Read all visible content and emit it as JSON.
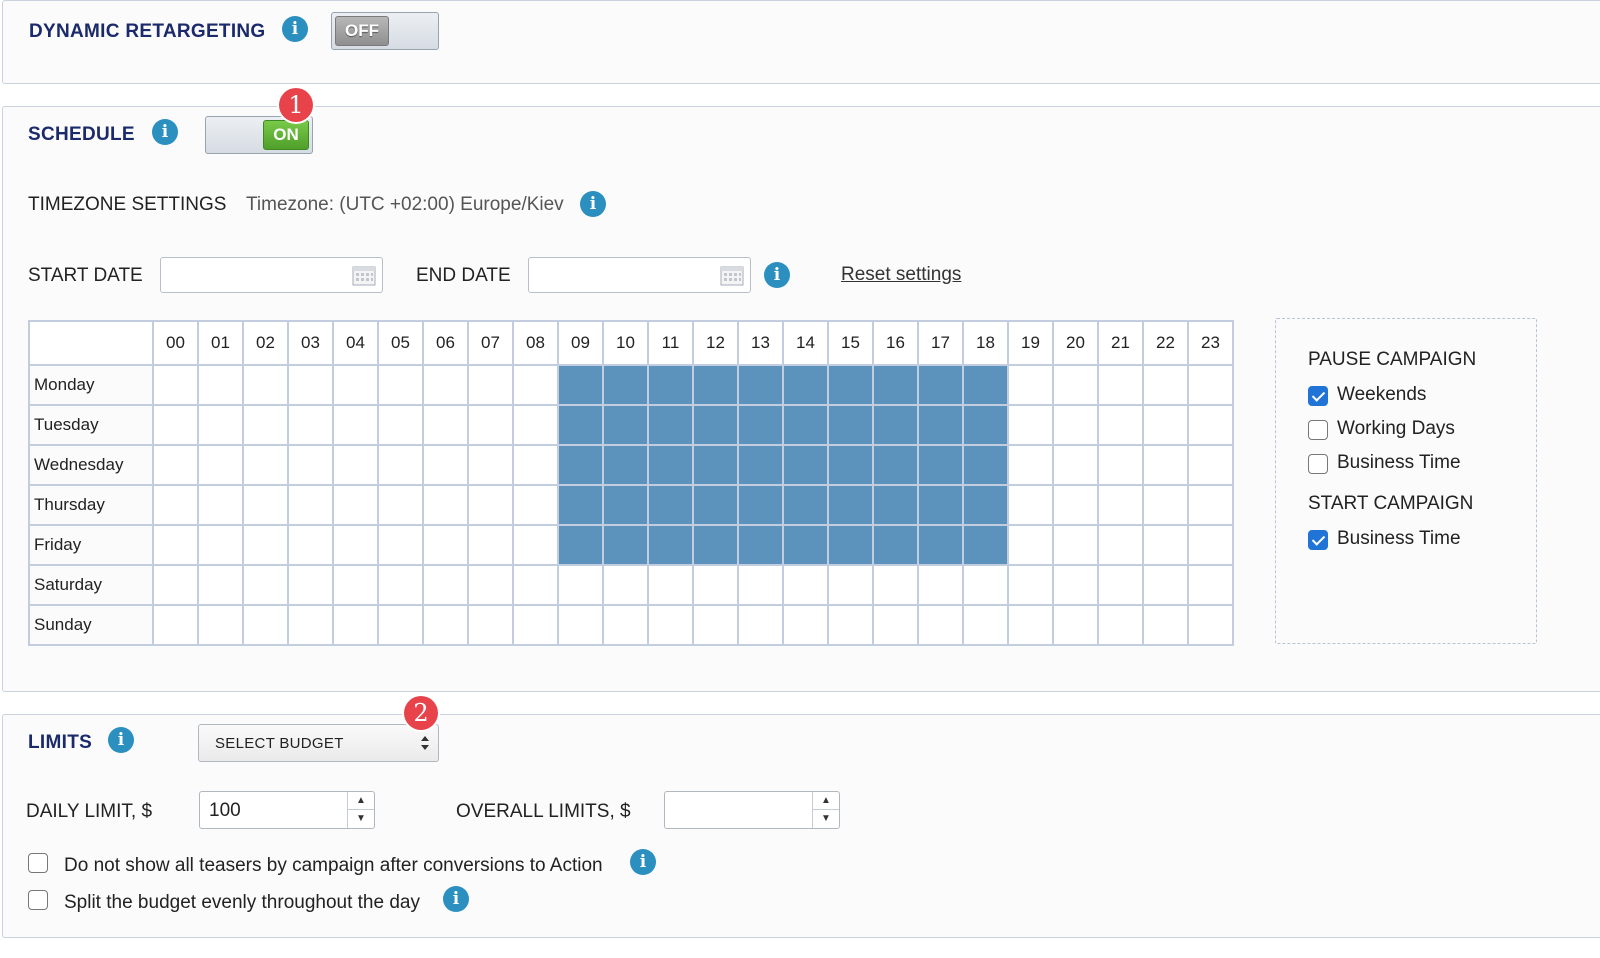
{
  "dynamic": {
    "title": "DYNAMIC RETARGETING",
    "toggle": "OFF"
  },
  "schedule": {
    "title": "SCHEDULE",
    "toggle": "ON",
    "badge": "1",
    "timezone_label": "TIMEZONE SETTINGS",
    "timezone_value": "Timezone: (UTC +02:00) Europe/Kiev",
    "start_date_label": "START DATE",
    "end_date_label": "END DATE",
    "reset": "Reset settings",
    "hours": [
      "00",
      "01",
      "02",
      "03",
      "04",
      "05",
      "06",
      "07",
      "08",
      "09",
      "10",
      "11",
      "12",
      "13",
      "14",
      "15",
      "16",
      "17",
      "18",
      "19",
      "20",
      "21",
      "22",
      "23"
    ],
    "days": [
      "Monday",
      "Tuesday",
      "Wednesday",
      "Thursday",
      "Friday",
      "Saturday",
      "Sunday"
    ],
    "active_days": [
      "Monday",
      "Tuesday",
      "Wednesday",
      "Thursday",
      "Friday"
    ],
    "active_hours": [
      "09",
      "10",
      "11",
      "12",
      "13",
      "14",
      "15",
      "16",
      "17",
      "18"
    ],
    "pause_title": "PAUSE CAMPAIGN",
    "pause_options": [
      {
        "label": "Weekends",
        "checked": true
      },
      {
        "label": "Working Days",
        "checked": false
      },
      {
        "label": "Business Time",
        "checked": false
      }
    ],
    "start_title": "START CAMPAIGN",
    "start_options": [
      {
        "label": "Business Time",
        "checked": true
      }
    ]
  },
  "limits": {
    "title": "LIMITS",
    "badge": "2",
    "budget_select": "SELECT BUDGET",
    "daily_label": "DAILY LIMIT, $",
    "daily_value": "100",
    "overall_label": "OVERALL LIMITS, $",
    "overall_value": "",
    "option1": "Do not show all teasers by campaign after conversions to Action",
    "option2": "Split the budget evenly throughout the day"
  },
  "icons": {
    "info": "info-icon",
    "calendar": "calendar-icon"
  },
  "colors": {
    "accent": "#2b8fbf",
    "selected_cell": "#5b93bd",
    "toggle_on": "#5cb034",
    "badge": "#e8434b",
    "title": "#1b2a6b"
  }
}
